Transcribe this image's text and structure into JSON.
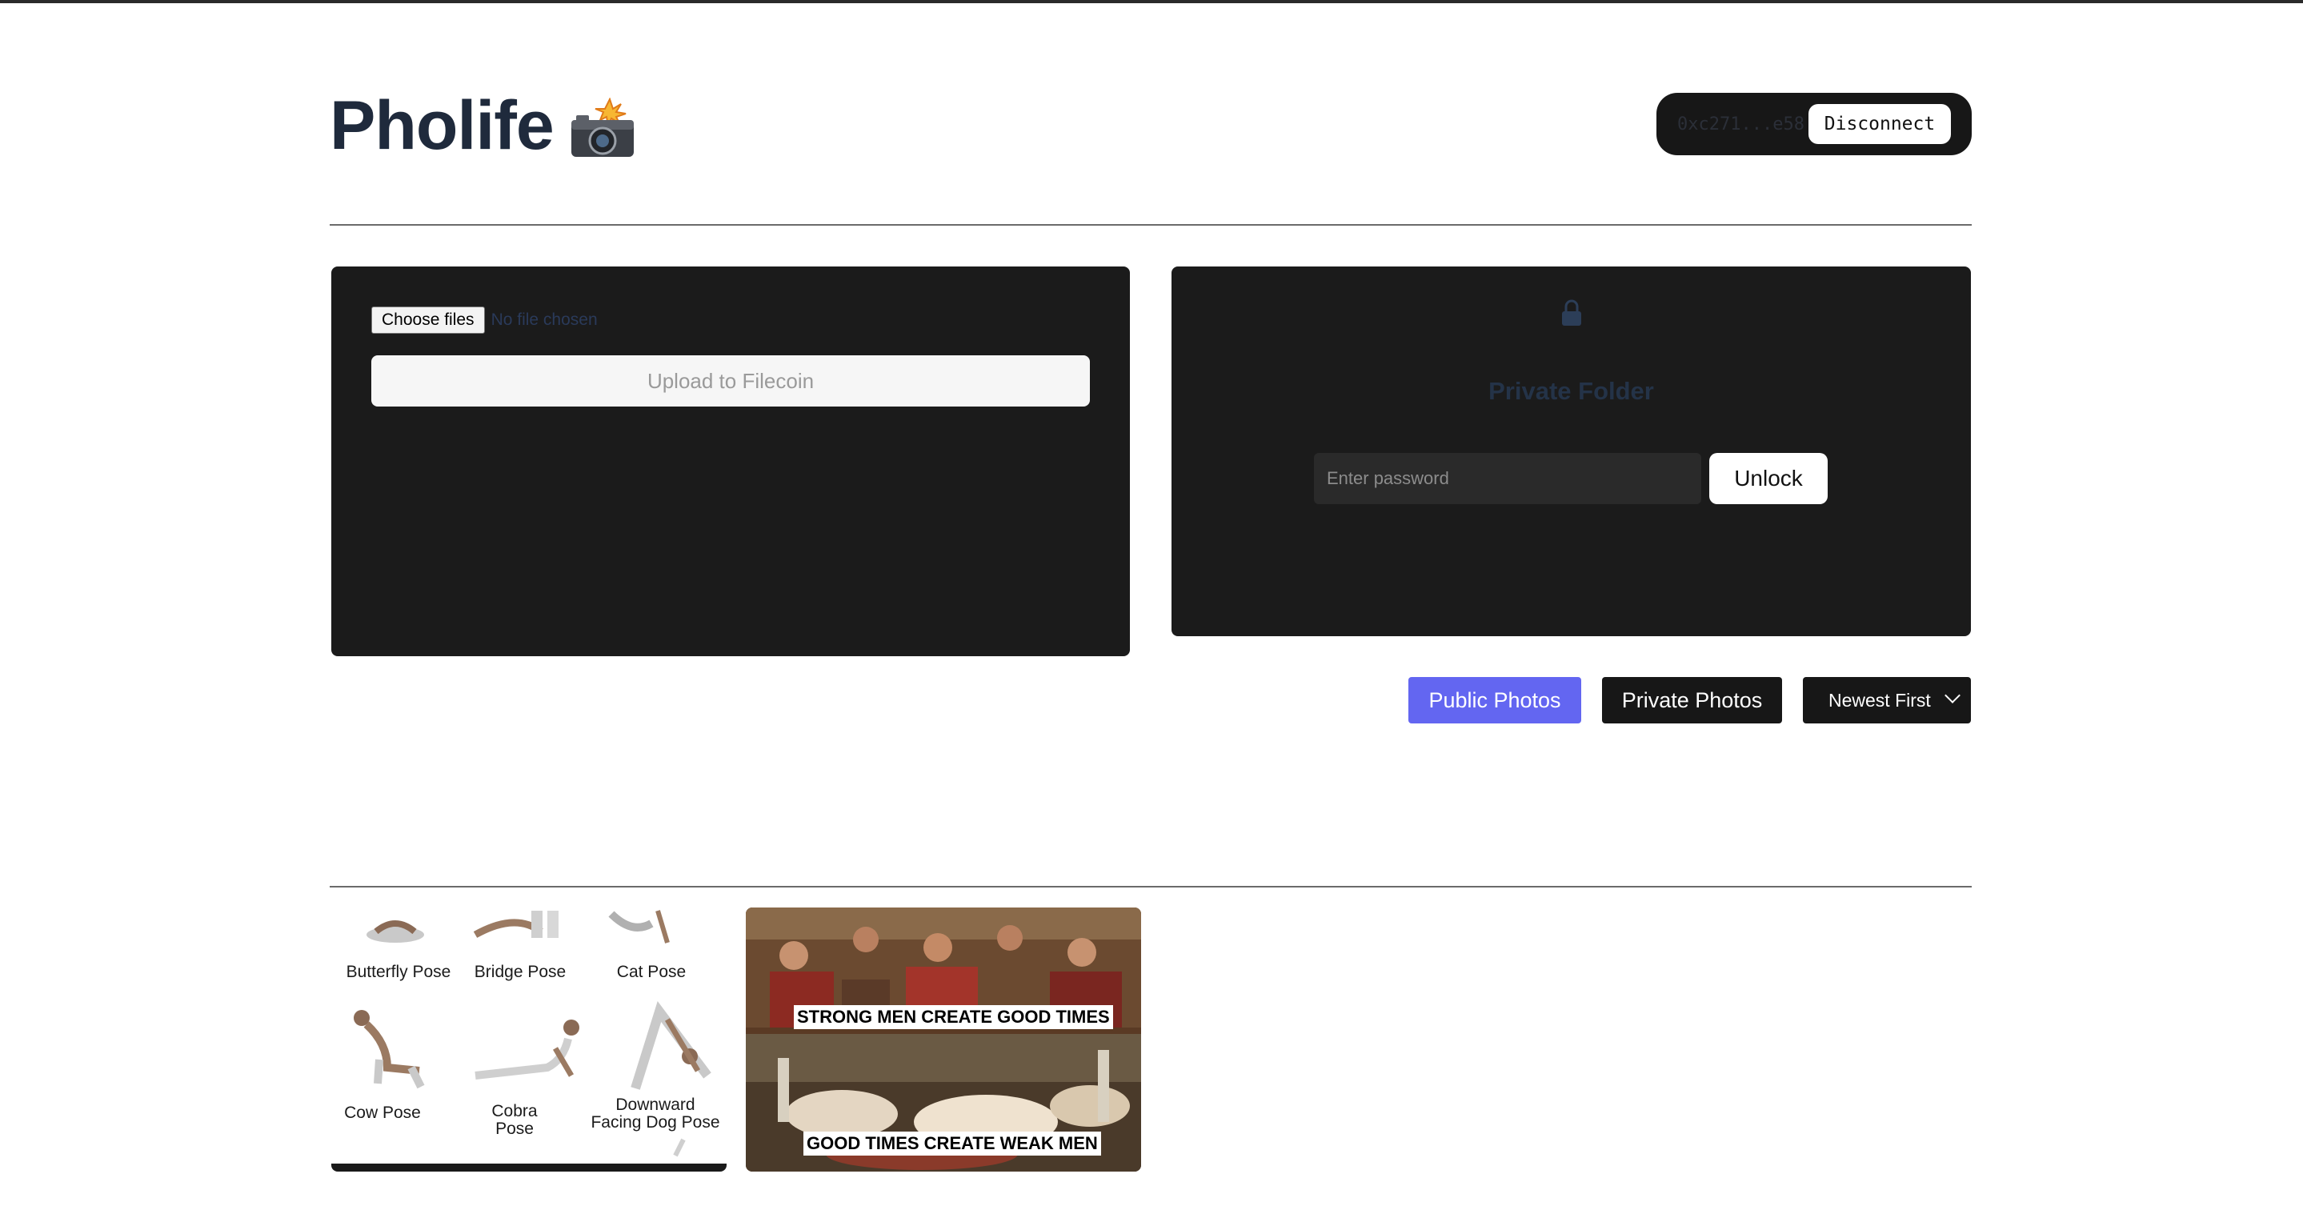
{
  "app": {
    "title": "Pholife",
    "title_icon": "camera-flash-icon"
  },
  "wallet": {
    "address": "0xc271...e58",
    "disconnect_label": "Disconnect"
  },
  "upload": {
    "choose_files_label": "Choose files",
    "no_file_text": "No file chosen",
    "upload_button_label": "Upload to Filecoin"
  },
  "private_folder": {
    "lock_icon": "lock-icon",
    "title": "Private Folder",
    "password_placeholder": "Enter password",
    "unlock_label": "Unlock"
  },
  "controls": {
    "public_label": "Public Photos",
    "private_label": "Private Photos",
    "sort_selected": "Newest First"
  },
  "gallery": {
    "yoga_poses": [
      "Butterfly Pose",
      "Bridge Pose",
      "Cat Pose",
      "Cow Pose",
      "Cobra Pose",
      "Downward\nFacing Dog Pose"
    ],
    "meme_top": "STRONG MEN CREATE GOOD TIMES",
    "meme_bottom": "GOOD TIMES CREATE WEAK MEN"
  },
  "colors": {
    "accent": "#6366f1",
    "panel": "#1b1b1b",
    "title": "#1f2a3c"
  }
}
